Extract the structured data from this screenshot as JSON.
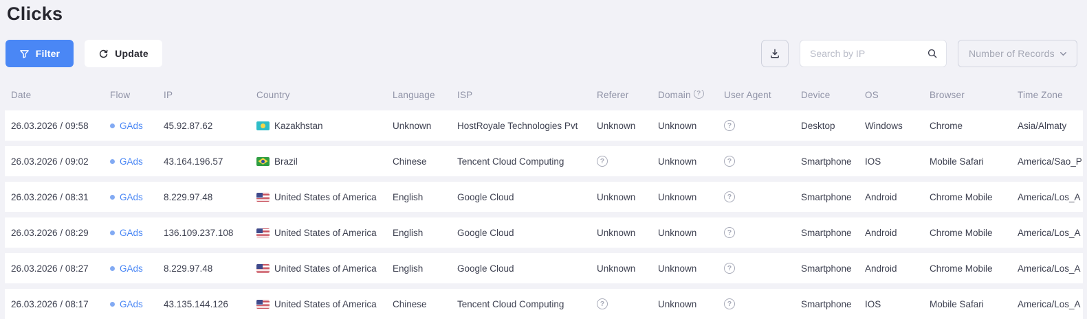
{
  "page": {
    "title": "Clicks"
  },
  "toolbar": {
    "filter_label": "Filter",
    "update_label": "Update",
    "search_placeholder": "Search by IP",
    "records_select_label": "Number of Records"
  },
  "icons": {
    "question": "?"
  },
  "colors": {
    "background": "#f2f2f7",
    "accent_blue": "#4a87f5",
    "row_background": "#ffffff",
    "header_text": "#8f92a6",
    "cell_text": "#3d4050"
  },
  "table": {
    "columns": {
      "date": "Date",
      "flow": "Flow",
      "ip": "IP",
      "country": "Country",
      "language": "Language",
      "isp": "ISP",
      "referer": "Referer",
      "domain": "Domain",
      "user_agent": "User Agent",
      "device": "Device",
      "os": "OS",
      "browser": "Browser",
      "time_zone": "Time Zone"
    },
    "rows": [
      {
        "date": "26.03.2026 / 09:58",
        "flow": "GAds",
        "ip": "45.92.87.62",
        "country": "Kazakhstan",
        "flag": "kz",
        "language": "Unknown",
        "isp": "HostRoyale Technologies Pvt",
        "referer": "Unknown",
        "domain": "Unknown",
        "user_agent": "?",
        "device": "Desktop",
        "os": "Windows",
        "browser": "Chrome",
        "time_zone": "Asia/Almaty"
      },
      {
        "date": "26.03.2026 / 09:02",
        "flow": "GAds",
        "ip": "43.164.196.57",
        "country": "Brazil",
        "flag": "br",
        "language": "Chinese",
        "isp": "Tencent Cloud Computing",
        "referer": "?",
        "domain": "Unknown",
        "user_agent": "?",
        "device": "Smartphone",
        "os": "IOS",
        "browser": "Mobile Safari",
        "time_zone": "America/Sao_P"
      },
      {
        "date": "26.03.2026 / 08:31",
        "flow": "GAds",
        "ip": "8.229.97.48",
        "country": "United States of America",
        "flag": "us",
        "language": "English",
        "isp": "Google Cloud",
        "referer": "Unknown",
        "domain": "Unknown",
        "user_agent": "?",
        "device": "Smartphone",
        "os": "Android",
        "browser": "Chrome Mobile",
        "time_zone": "America/Los_A"
      },
      {
        "date": "26.03.2026 / 08:29",
        "flow": "GAds",
        "ip": "136.109.237.108",
        "country": "United States of America",
        "flag": "us",
        "language": "English",
        "isp": "Google Cloud",
        "referer": "Unknown",
        "domain": "Unknown",
        "user_agent": "?",
        "device": "Smartphone",
        "os": "Android",
        "browser": "Chrome Mobile",
        "time_zone": "America/Los_A"
      },
      {
        "date": "26.03.2026 / 08:27",
        "flow": "GAds",
        "ip": "8.229.97.48",
        "country": "United States of America",
        "flag": "us",
        "language": "English",
        "isp": "Google Cloud",
        "referer": "Unknown",
        "domain": "Unknown",
        "user_agent": "?",
        "device": "Smartphone",
        "os": "Android",
        "browser": "Chrome Mobile",
        "time_zone": "America/Los_A"
      },
      {
        "date": "26.03.2026 / 08:17",
        "flow": "GAds",
        "ip": "43.135.144.126",
        "country": "United States of America",
        "flag": "us",
        "language": "Chinese",
        "isp": "Tencent Cloud Computing",
        "referer": "?",
        "domain": "Unknown",
        "user_agent": "?",
        "device": "Smartphone",
        "os": "IOS",
        "browser": "Mobile Safari",
        "time_zone": "America/Los_A"
      }
    ]
  }
}
